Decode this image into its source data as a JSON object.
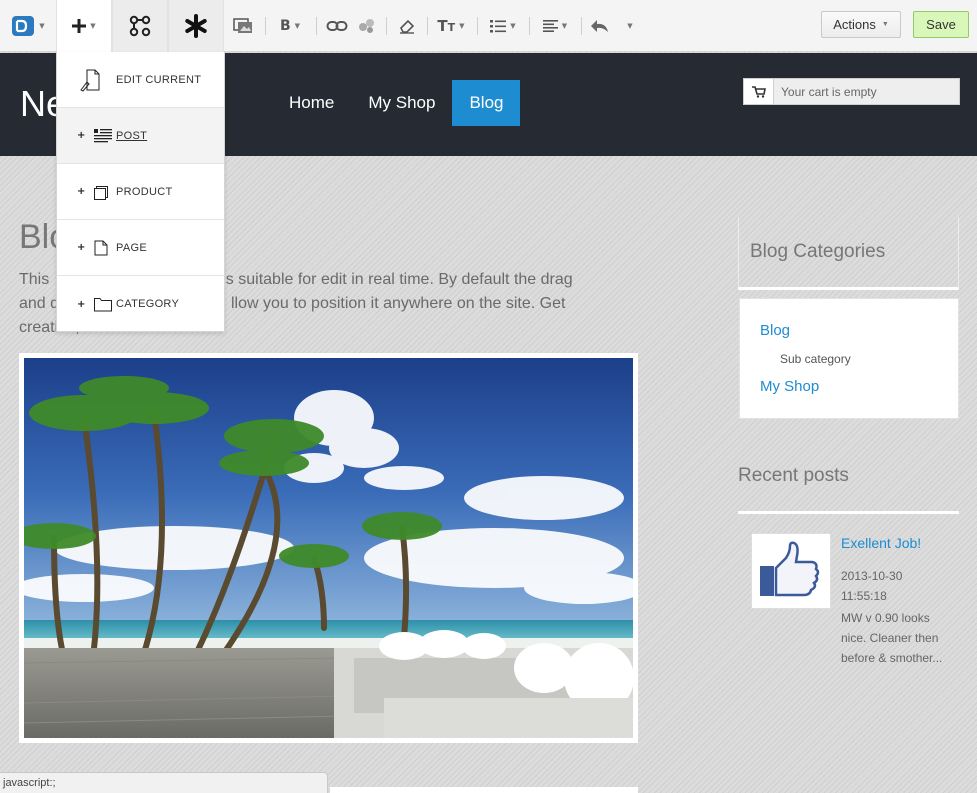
{
  "toolbar": {
    "actions_label": "Actions",
    "save_label": "Save"
  },
  "header": {
    "site_name_visible": "Ne",
    "nav": [
      {
        "label": "Home"
      },
      {
        "label": "My Shop"
      },
      {
        "label": "Blog"
      }
    ],
    "active_nav": "Blog",
    "cart_text": "Your cart is empty"
  },
  "add_menu": {
    "items": [
      {
        "label": "EDIT CURRENT",
        "icon": "edit-page-icon"
      },
      {
        "label": "POST",
        "icon": "post-icon"
      },
      {
        "label": "PRODUCT",
        "icon": "product-icon"
      },
      {
        "label": "PAGE",
        "icon": "page-icon"
      },
      {
        "label": "CATEGORY",
        "icon": "folder-icon"
      }
    ]
  },
  "main": {
    "title_visible": "Blo",
    "intro_lines": [
      "This",
      "nd is suitable for edit in real time. By default the drag",
      "and d",
      "llow you to position it anywhere on the site. Get",
      "creative, Make Web."
    ]
  },
  "sidebar": {
    "categories_title": "Blog Categories",
    "categories": [
      {
        "label": "Blog"
      },
      {
        "label": "Sub category"
      },
      {
        "label": "My Shop"
      }
    ],
    "recent_title": "Recent posts",
    "recent_post": {
      "title": "Exellent Job!",
      "date_line1": "2013-10-30",
      "date_line2": "11:55:18",
      "excerpt": "MW v 0.90 looks nice. Cleaner then before & smother..."
    }
  },
  "status_bar": "javascript:;",
  "colors": {
    "accent": "#1e8cd0",
    "header_bg": "#252a33",
    "save_bg": "#d9f7b8"
  }
}
